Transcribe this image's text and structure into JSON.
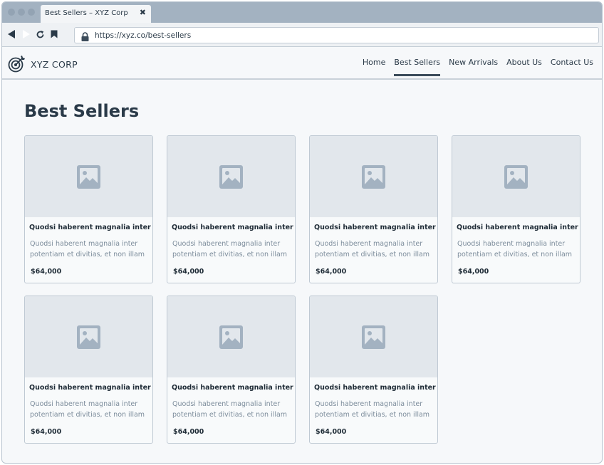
{
  "browser": {
    "tab_title": "Best Sellers – XYZ Corp",
    "close_glyph": "✖",
    "url": "https://xyz.co/best-sellers"
  },
  "site": {
    "brand": "XYZ CORP",
    "logo_icon": "target-icon",
    "nav": [
      {
        "label": "Home",
        "active": false
      },
      {
        "label": "Best Sellers",
        "active": true
      },
      {
        "label": "New Arrivals",
        "active": false
      },
      {
        "label": "About Us",
        "active": false
      },
      {
        "label": "Contact Us",
        "active": false
      }
    ]
  },
  "main": {
    "title": "Best Sellers",
    "products": [
      {
        "title": "Quodsi haberent magnalia inter",
        "description": "Quodsi haberent magnalia inter potentiam et divitias, et non illam",
        "price": "$64,000"
      },
      {
        "title": "Quodsi haberent magnalia inter",
        "description": "Quodsi haberent magnalia inter potentiam et divitias, et non illam",
        "price": "$64,000"
      },
      {
        "title": "Quodsi haberent magnalia inter",
        "description": "Quodsi haberent magnalia inter potentiam et divitias, et non illam",
        "price": "$64,000"
      },
      {
        "title": "Quodsi haberent magnalia inter",
        "description": "Quodsi haberent magnalia inter potentiam et divitias, et non illam",
        "price": "$64,000"
      },
      {
        "title": "Quodsi haberent magnalia inter",
        "description": "Quodsi haberent magnalia inter potentiam et divitias, et non illam",
        "price": "$64,000"
      },
      {
        "title": "Quodsi haberent magnalia inter",
        "description": "Quodsi haberent magnalia inter potentiam et divitias, et non illam",
        "price": "$64,000"
      },
      {
        "title": "Quodsi haberent magnalia inter",
        "description": "Quodsi haberent magnalia inter potentiam et divitias, et non illam",
        "price": "$64,000"
      }
    ]
  },
  "colors": {
    "accent": "#3b4b5a",
    "placeholder": "#a3b2c1"
  }
}
